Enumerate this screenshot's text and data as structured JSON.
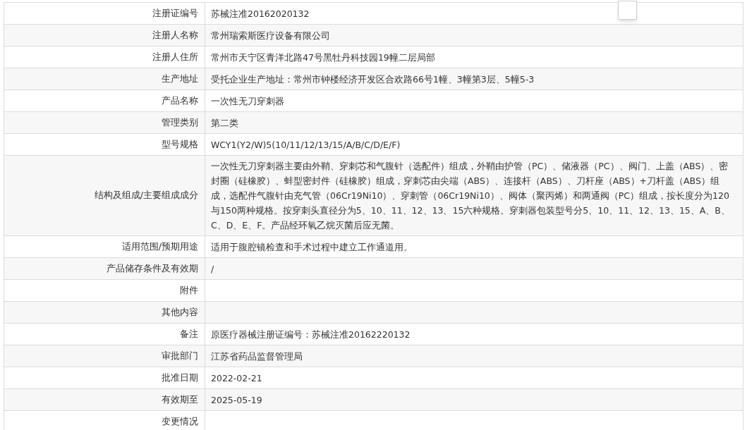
{
  "rows": [
    {
      "label": "注册证编号",
      "value": "苏械注准20162020132"
    },
    {
      "label": "注册人名称",
      "value": "常州瑞索斯医疗设备有限公司"
    },
    {
      "label": "注册人住所",
      "value": "常州市天宁区青洋北路47号黑牡丹科技园19幢二层局部"
    },
    {
      "label": "生产地址",
      "value": "受托企业生产地址：常州市钟楼经济开发区合欢路66号1幢、3幢第3层、5幢5-3"
    },
    {
      "label": "产品名称",
      "value": "一次性无刀穿刺器"
    },
    {
      "label": "管理类别",
      "value": "第二类"
    },
    {
      "label": "型号规格",
      "value": "WCY1(Y2/W)5(10/11/12/13/15/A/B/C/D/E/F)"
    },
    {
      "label": "结构及组成/主要组成成分",
      "value": "一次性无刀穿刺器主要由外鞘、穿刺芯和气腹针（选配件）组成，外鞘由护管（PC）、储液器（PC）、阀门、上盖（ABS）、密封圈（硅橡胶）、蚌型密封件（硅橡胶）组成，穿刺芯由尖端（ABS）、连接杆（ABS）、刀杆座（ABS）+刀杆盖（ABS）组成，选配件气腹针由充气管（06Cr19Ni10）、穿刺管（06Cr19Ni10）、阀体（聚丙烯）和两通阀（PC）组成，按长度分为120与150两种规格。按穿刺头直径分为5、10、11、12、13、15六种规格。穿刺器包装型号分5、10、11、12、13、15、A、B、C、D、E、F。产品经环氧乙烷灭菌后应无菌。"
    },
    {
      "label": "适用范围/预期用途",
      "value": "适用于腹腔镜检查和手术过程中建立工作通道用。"
    },
    {
      "label": "产品储存条件及有效期",
      "value": "/"
    },
    {
      "label": "附件"
    },
    {
      "label": "其他内容"
    },
    {
      "label": "备注",
      "value": "原医疗器械注册证编号：苏械注准20162220132"
    },
    {
      "label": "审批部门",
      "value": "江苏省药品监督管理局"
    },
    {
      "label": "批准日期",
      "value": "2022-02-21"
    },
    {
      "label": "有效期至",
      "value": "2025-05-19"
    },
    {
      "label": "变更情况"
    }
  ]
}
